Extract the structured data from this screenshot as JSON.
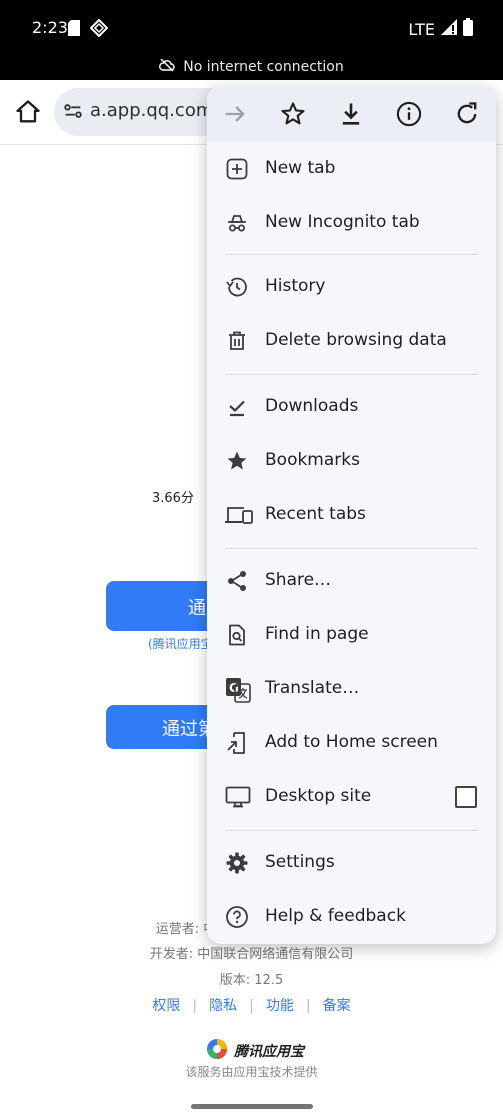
{
  "status_bar": {
    "time": "2:23",
    "network": "LTE",
    "banner": "No internet connection"
  },
  "toolbar": {
    "url": "a.app.qq.com/"
  },
  "page": {
    "rating": "3.66分",
    "button1_label": "通",
    "button1_note": "(腾讯应用宝",
    "button2_label": "通过第",
    "operator_label": "运营者: 中国",
    "developer_label": "开发者: 中国联合网络通信有限公司",
    "version_label": "版本: 12.5",
    "links": [
      "权限",
      "隐私",
      "功能",
      "备案"
    ],
    "brand_name": "腾讯应用宝",
    "brand_note": "该服务由应用宝技术提供"
  },
  "menu": {
    "top_buttons": [
      "forward-icon",
      "bookmark-star-icon",
      "download-icon",
      "info-icon",
      "refresh-icon"
    ],
    "items": [
      {
        "label": "New tab",
        "icon": "new-tab-icon"
      },
      {
        "label": "New Incognito tab",
        "icon": "incognito-icon"
      },
      {
        "label": "History",
        "icon": "history-icon"
      },
      {
        "label": "Delete browsing data",
        "icon": "trash-icon"
      },
      {
        "label": "Downloads",
        "icon": "downloads-icon"
      },
      {
        "label": "Bookmarks",
        "icon": "bookmarks-icon"
      },
      {
        "label": "Recent tabs",
        "icon": "recent-tabs-icon"
      },
      {
        "label": "Share…",
        "icon": "share-icon"
      },
      {
        "label": "Find in page",
        "icon": "find-in-page-icon"
      },
      {
        "label": "Translate…",
        "icon": "translate-icon"
      },
      {
        "label": "Add to Home screen",
        "icon": "add-to-home-icon"
      },
      {
        "label": "Desktop site",
        "icon": "desktop-icon",
        "checked": false
      },
      {
        "label": "Settings",
        "icon": "settings-icon"
      },
      {
        "label": "Help & feedback",
        "icon": "help-icon"
      }
    ]
  },
  "colors": {
    "accent": "#2f7cf6",
    "menu_bg": "#f6f7fb"
  }
}
